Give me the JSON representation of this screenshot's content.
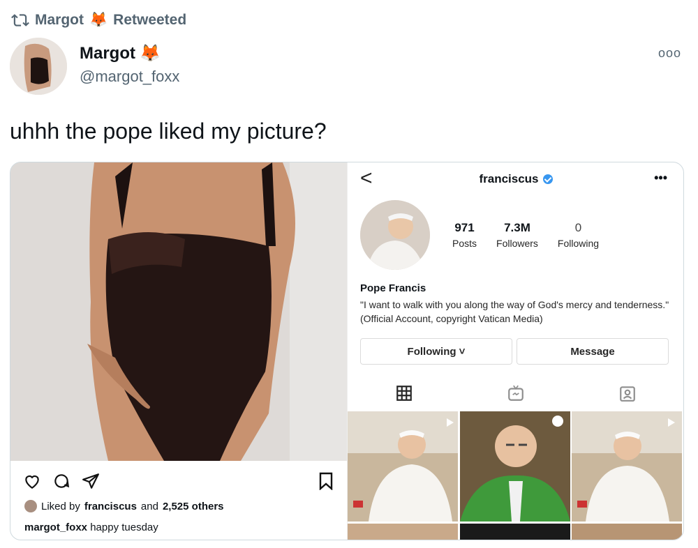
{
  "retweet": {
    "icon": "retweet-icon",
    "user": "Margot",
    "label": "Retweeted"
  },
  "author": {
    "name": "Margot",
    "handle": "@margot_foxx",
    "emoji": "fox-emoji"
  },
  "more": "ooo",
  "tweet": {
    "text": "uhhh the pope liked my picture?"
  },
  "post": {
    "likes_user": "franciscus",
    "likes_text": "Liked by",
    "likes_and": "and",
    "likes_others": "2,525 others",
    "caption_user": "margot_foxx",
    "caption_text": "happy tuesday"
  },
  "profile": {
    "back": "<",
    "username": "franciscus",
    "more": "•••",
    "posts": "971",
    "posts_label": "Posts",
    "followers": "7.3M",
    "followers_label": "Followers",
    "following": "0",
    "following_label": "Following",
    "display_name": "Pope Francis",
    "bio": "\"I want to walk with you along the way of God's mercy and tenderness.\" (Official Account, copyright Vatican Media)",
    "follow_button": "Following ˅",
    "message_button": "Message"
  },
  "colors": {
    "verified": "#3897f0",
    "muted": "#536471"
  }
}
